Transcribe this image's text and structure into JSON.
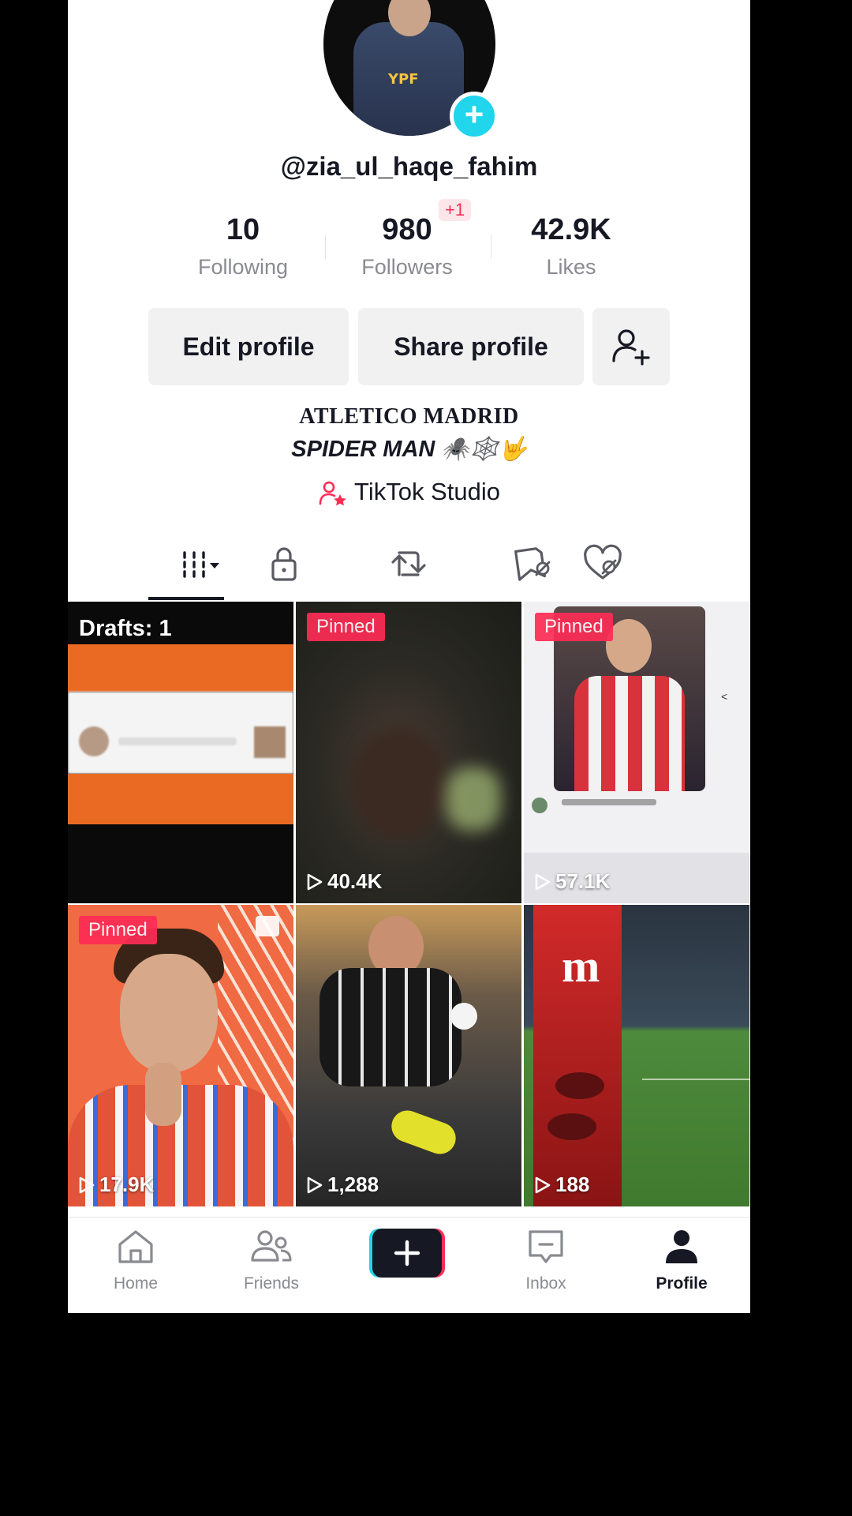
{
  "profile": {
    "username": "@zia_ul_haqe_fahim",
    "stats": {
      "following": {
        "value": "10",
        "label": "Following"
      },
      "followers": {
        "value": "980",
        "label": "Followers",
        "delta": "+1"
      },
      "likes": {
        "value": "42.9K",
        "label": "Likes"
      }
    },
    "buttons": {
      "edit": "Edit profile",
      "share": "Share profile"
    },
    "bio": {
      "line1": "ATLETICO MADRID",
      "line2": "SPIDER MAN 🕷️🕸️🤟"
    },
    "studio_link": "TikTok Studio",
    "avatar_jersey_text": "YPF"
  },
  "tabs": [
    "videos-grid-icon",
    "lock-icon",
    "repost-icon",
    "favorites-icon",
    "liked-icon"
  ],
  "grid": [
    {
      "badge": "Drafts: 1",
      "views": ""
    },
    {
      "badge": "Pinned",
      "views": "40.4K"
    },
    {
      "badge": "Pinned",
      "views": "57.1K"
    },
    {
      "badge": "Pinned",
      "views": "17.9K"
    },
    {
      "badge": "",
      "views": "1,288"
    },
    {
      "badge": "",
      "views": "188"
    }
  ],
  "nav": {
    "home": "Home",
    "friends": "Friends",
    "inbox": "Inbox",
    "profile": "Profile"
  },
  "colors": {
    "accent": "#fe2c55",
    "avatar_badge": "#20d5ec"
  }
}
